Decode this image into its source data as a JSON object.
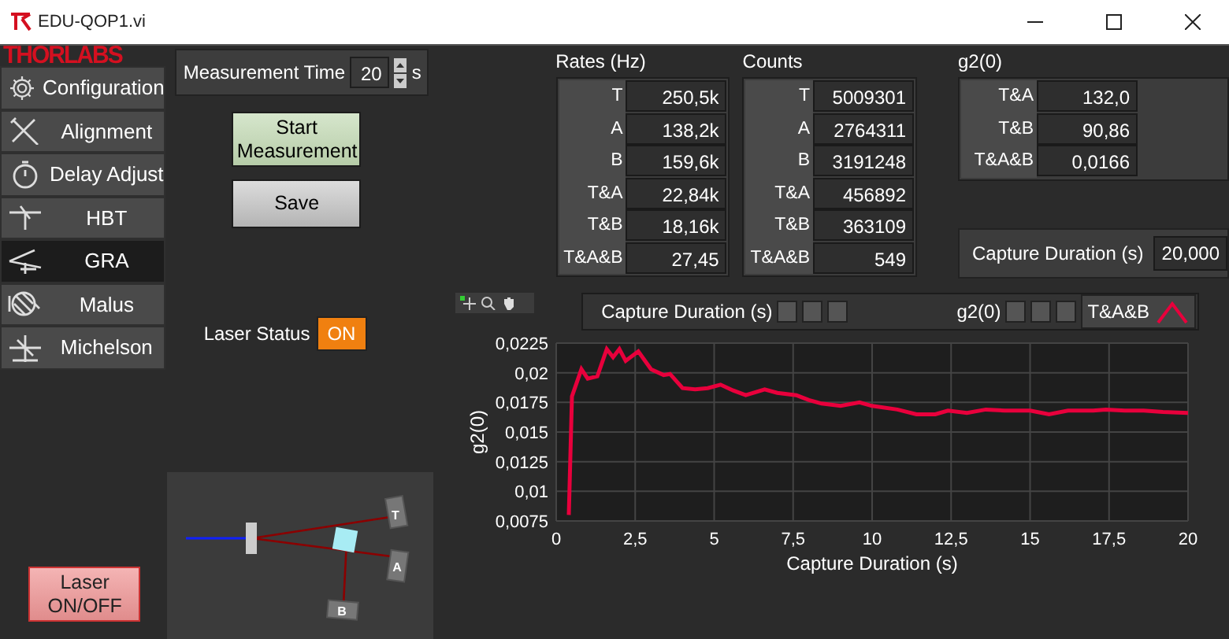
{
  "window": {
    "title": "EDU-QOP1.vi"
  },
  "logo": "THORLABS",
  "sidebar": {
    "items": [
      {
        "label": "Configuration",
        "kind": "gear",
        "selected": false
      },
      {
        "label": "Alignment",
        "kind": "tools",
        "selected": false
      },
      {
        "label": "Delay Adjust",
        "kind": "stopwatch",
        "selected": false
      },
      {
        "label": "HBT",
        "kind": "hbt",
        "selected": false
      },
      {
        "label": "GRA",
        "kind": "gra",
        "selected": true
      },
      {
        "label": "Malus",
        "kind": "malus",
        "selected": false
      },
      {
        "label": "Michelson",
        "kind": "michelson",
        "selected": false
      }
    ]
  },
  "measurement_time": {
    "label": "Measurement Time",
    "value": "20",
    "unit": "s"
  },
  "buttons": [
    {
      "label": "Start Measurement",
      "kind": "start"
    },
    {
      "label": "Save",
      "kind": "save"
    }
  ],
  "laser_status": {
    "label": "Laser Status",
    "value": "ON",
    "on": true
  },
  "setup": {
    "detectors": [
      "T",
      "A",
      "B"
    ]
  },
  "laser_button": {
    "label": "Laser ON/OFF"
  },
  "tables": [
    {
      "title": "Rates (Hz)",
      "rows": [
        {
          "label": "T",
          "value": "250,5k"
        },
        {
          "label": "A",
          "value": "138,2k"
        },
        {
          "label": "B",
          "value": "159,6k"
        },
        {
          "label": "T&A",
          "value": "22,84k"
        },
        {
          "label": "T&B",
          "value": "18,16k"
        },
        {
          "label": "T&A&B",
          "value": "27,45"
        }
      ]
    },
    {
      "title": "Counts",
      "rows": [
        {
          "label": "T",
          "value": "5009301"
        },
        {
          "label": "A",
          "value": "2764311"
        },
        {
          "label": "B",
          "value": "3191248"
        },
        {
          "label": "T&A",
          "value": "456892"
        },
        {
          "label": "T&B",
          "value": "363109"
        },
        {
          "label": "T&A&B",
          "value": "549"
        }
      ]
    },
    {
      "title": "g2(0)",
      "rows": [
        {
          "label": "T&A",
          "value": "132,0"
        },
        {
          "label": "T&B",
          "value": "90,86"
        },
        {
          "label": "T&A&B",
          "value": "0,0166"
        }
      ]
    }
  ],
  "capture_duration": {
    "label": "Capture Duration (s)",
    "value": "20,000"
  },
  "graph": {
    "legend_x": "Capture Duration (s)",
    "legend_y": "g2(0)",
    "chart_data": {
      "type": "line",
      "grid": true,
      "xlabel": "Capture Duration (s)",
      "ylabel": "g2(0)",
      "xlim": [
        0,
        20
      ],
      "ylim": [
        0.0075,
        0.0225
      ],
      "xticks": [
        {
          "value": 0,
          "label": "0"
        },
        {
          "value": 2.5,
          "label": "2,5"
        },
        {
          "value": 5,
          "label": "5"
        },
        {
          "value": 7.5,
          "label": "7,5"
        },
        {
          "value": 10,
          "label": "10"
        },
        {
          "value": 12.5,
          "label": "12,5"
        },
        {
          "value": 15,
          "label": "15"
        },
        {
          "value": 17.5,
          "label": "17,5"
        },
        {
          "value": 20,
          "label": "20"
        }
      ],
      "yticks": [
        {
          "value": 0.0075,
          "label": "0,0075"
        },
        {
          "value": 0.01,
          "label": "0,01"
        },
        {
          "value": 0.0125,
          "label": "0,0125"
        },
        {
          "value": 0.015,
          "label": "0,015"
        },
        {
          "value": 0.0175,
          "label": "0,0175"
        },
        {
          "value": 0.02,
          "label": "0,02"
        },
        {
          "value": 0.0225,
          "label": "0,0225"
        }
      ],
      "x": [
        0.4,
        0.5,
        0.8,
        1.0,
        1.3,
        1.6,
        1.8,
        2.0,
        2.2,
        2.6,
        3.0,
        3.4,
        3.6,
        4.0,
        4.4,
        4.8,
        5.2,
        5.6,
        6.0,
        6.6,
        7.0,
        7.6,
        8.0,
        8.4,
        9.0,
        9.6,
        10,
        10.8,
        11.4,
        12,
        12.4,
        13,
        13.6,
        14.2,
        15,
        15.6,
        16.2,
        17,
        17.4,
        18,
        18.6,
        19.2,
        20
      ],
      "series": [
        {
          "name": "T&A&B",
          "color": "#e8003c",
          "values": [
            0.008,
            0.018,
            0.0203,
            0.0195,
            0.0197,
            0.022,
            0.0213,
            0.022,
            0.021,
            0.0218,
            0.0203,
            0.0198,
            0.0199,
            0.0187,
            0.0186,
            0.0187,
            0.019,
            0.0185,
            0.0181,
            0.0186,
            0.0183,
            0.0181,
            0.0177,
            0.0174,
            0.0172,
            0.0175,
            0.0172,
            0.0169,
            0.0165,
            0.0165,
            0.0168,
            0.0166,
            0.0169,
            0.0168,
            0.0168,
            0.0165,
            0.0168,
            0.0168,
            0.0169,
            0.0168,
            0.0168,
            0.0167,
            0.0166
          ]
        }
      ]
    }
  }
}
